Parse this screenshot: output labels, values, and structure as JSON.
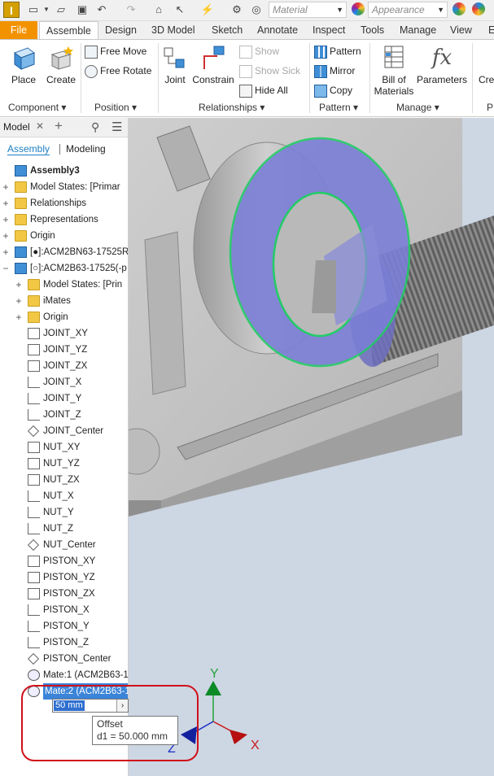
{
  "qat": {
    "material_placeholder": "Material",
    "appearance_placeholder": "Appearance"
  },
  "tabs": [
    "File",
    "Assemble",
    "Design",
    "3D Model",
    "Sketch",
    "Annotate",
    "Inspect",
    "Tools",
    "Manage",
    "View",
    "E"
  ],
  "ribbon": {
    "place": "Place",
    "create": "Create",
    "free_move": "Free Move",
    "free_rotate": "Free Rotate",
    "joint": "Joint",
    "constrain": "Constrain",
    "show": "Show",
    "show_sick": "Show Sick",
    "hide_all": "Hide All",
    "pattern": "Pattern",
    "mirror": "Mirror",
    "copy": "Copy",
    "bill_of": "Bill of",
    "materials": "Materials",
    "parameters": "Parameters",
    "cre": "Cre",
    "groups": {
      "component": "Component",
      "position": "Position",
      "relationships": "Relationships",
      "pattern": "Pattern",
      "manage": "Manage",
      "p": "P"
    }
  },
  "browser": {
    "title": "Model",
    "plus": "+",
    "mode_assembly": "Assembly",
    "mode_modeling": "Modeling",
    "items": [
      {
        "label": "Assembly3",
        "indent": 0,
        "icon": "assembly-icon",
        "exp": ""
      },
      {
        "label": "Model States: [Primar",
        "indent": 0,
        "icon": "folder-icon",
        "exp": "+"
      },
      {
        "label": "Relationships",
        "indent": 0,
        "icon": "folder-icon",
        "exp": "+"
      },
      {
        "label": "Representations",
        "indent": 0,
        "icon": "representation-icon",
        "exp": "+"
      },
      {
        "label": "Origin",
        "indent": 0,
        "icon": "folder-icon",
        "exp": "+"
      },
      {
        "label": "[●]:ACM2BN63-17525R",
        "indent": 0,
        "icon": "part-icon",
        "exp": "+"
      },
      {
        "label": "[○]:ACM2B63-17525(-p",
        "indent": 0,
        "icon": "part-icon",
        "exp": "−"
      },
      {
        "label": "Model States: [Prin",
        "indent": 1,
        "icon": "folder-icon",
        "exp": "+"
      },
      {
        "label": "iMates",
        "indent": 1,
        "icon": "folder-icon",
        "exp": "+"
      },
      {
        "label": "Origin",
        "indent": 1,
        "icon": "folder-icon",
        "exp": "+"
      },
      {
        "label": "JOINT_XY",
        "indent": 1,
        "icon": "work-plane-icon",
        "exp": ""
      },
      {
        "label": "JOINT_YZ",
        "indent": 1,
        "icon": "work-plane-icon",
        "exp": ""
      },
      {
        "label": "JOINT_ZX",
        "indent": 1,
        "icon": "work-plane-icon",
        "exp": ""
      },
      {
        "label": "JOINT_X",
        "indent": 1,
        "icon": "work-axis-icon",
        "exp": ""
      },
      {
        "label": "JOINT_Y",
        "indent": 1,
        "icon": "work-axis-icon",
        "exp": ""
      },
      {
        "label": "JOINT_Z",
        "indent": 1,
        "icon": "work-axis-icon",
        "exp": ""
      },
      {
        "label": "JOINT_Center",
        "indent": 1,
        "icon": "work-point-icon",
        "exp": ""
      },
      {
        "label": "NUT_XY",
        "indent": 1,
        "icon": "work-plane-icon",
        "exp": ""
      },
      {
        "label": "NUT_YZ",
        "indent": 1,
        "icon": "work-plane-icon",
        "exp": ""
      },
      {
        "label": "NUT_ZX",
        "indent": 1,
        "icon": "work-plane-icon",
        "exp": ""
      },
      {
        "label": "NUT_X",
        "indent": 1,
        "icon": "work-axis-icon",
        "exp": ""
      },
      {
        "label": "NUT_Y",
        "indent": 1,
        "icon": "work-axis-icon",
        "exp": ""
      },
      {
        "label": "NUT_Z",
        "indent": 1,
        "icon": "work-axis-icon",
        "exp": ""
      },
      {
        "label": "NUT_Center",
        "indent": 1,
        "icon": "work-point-icon",
        "exp": ""
      },
      {
        "label": "PISTON_XY",
        "indent": 1,
        "icon": "work-plane-icon",
        "exp": ""
      },
      {
        "label": "PISTON_YZ",
        "indent": 1,
        "icon": "work-plane-icon",
        "exp": ""
      },
      {
        "label": "PISTON_ZX",
        "indent": 1,
        "icon": "work-plane-icon",
        "exp": ""
      },
      {
        "label": "PISTON_X",
        "indent": 1,
        "icon": "work-axis-icon",
        "exp": ""
      },
      {
        "label": "PISTON_Y",
        "indent": 1,
        "icon": "work-axis-icon",
        "exp": ""
      },
      {
        "label": "PISTON_Z",
        "indent": 1,
        "icon": "work-axis-icon",
        "exp": ""
      },
      {
        "label": "PISTON_Center",
        "indent": 1,
        "icon": "work-point-icon",
        "exp": ""
      },
      {
        "label": "Mate:1 (ACM2B63-1",
        "indent": 1,
        "icon": "mate-icon",
        "exp": ""
      },
      {
        "label": "Mate:2 (ACM2B63-1",
        "indent": 1,
        "icon": "mate-icon",
        "exp": "",
        "selected": true
      }
    ]
  },
  "edit": {
    "value": "50 mm",
    "arrow": "›"
  },
  "tooltip": {
    "title": "Offset",
    "detail": "d1 = 50.000 mm"
  },
  "triad": {
    "x": "X",
    "y": "Y",
    "z": "Z"
  },
  "colors": {
    "file_tab": "#f39200",
    "highlight_edge": "#22cc66",
    "selected_face": "#7b7fd6",
    "viewport_bg": "#cdd6e3",
    "annotation_circle": "#d0101a"
  }
}
